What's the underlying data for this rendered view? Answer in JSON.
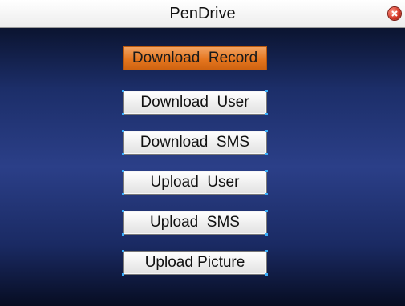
{
  "window": {
    "title": "PenDrive"
  },
  "icons": {
    "close": "close-icon"
  },
  "menu": {
    "items": [
      {
        "label": "Download  Record",
        "active": true
      },
      {
        "label": "Download  User",
        "active": false
      },
      {
        "label": "Download  SMS",
        "active": false
      },
      {
        "label": "Upload  User",
        "active": false
      },
      {
        "label": "Upload  SMS",
        "active": false
      },
      {
        "label": "Upload Picture",
        "active": false
      }
    ]
  },
  "colors": {
    "selected": "#e5761f",
    "background": "#2b3f88",
    "close": "#d53a2a"
  }
}
